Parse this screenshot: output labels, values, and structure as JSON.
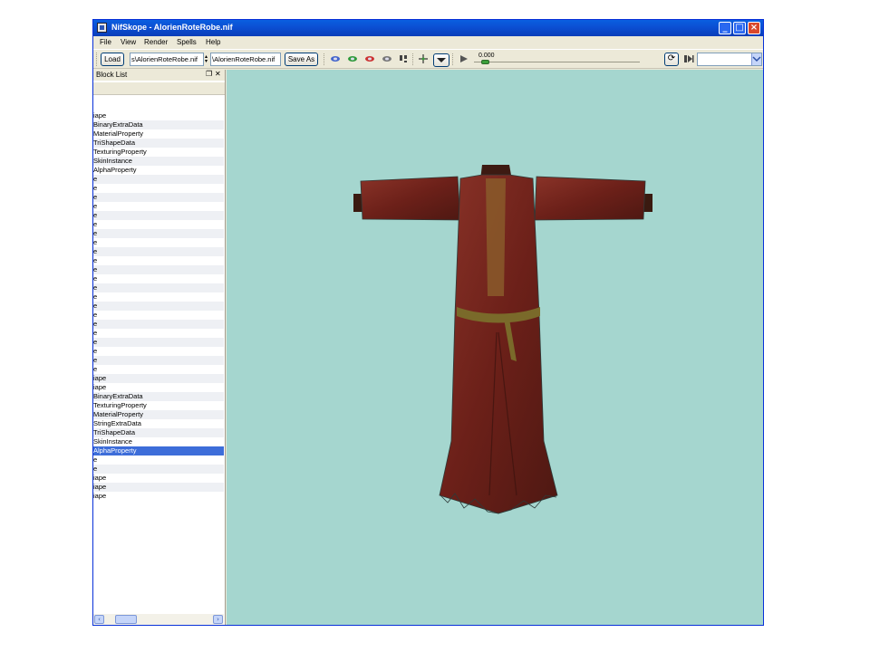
{
  "window": {
    "title": "NifSkope - AlorienRoteRobe.nif",
    "minimize_glyph": "_",
    "maximize_glyph": "□",
    "close_glyph": "×"
  },
  "menu": [
    "File",
    "View",
    "Render",
    "Spells",
    "Help"
  ],
  "toolbar": {
    "load_label": "Load",
    "load_path": "s\\AlorienRoteRobe.nif",
    "save_path": "\\AlorienRoteRobe.nif",
    "save_as_label": "Save As",
    "time_value": "0.000",
    "animation_select": ""
  },
  "block_list": {
    "header": "Block List",
    "rows": [
      "iape",
      "BinaryExtraData",
      "MaterialProperty",
      "TriShapeData",
      "TexturingProperty",
      "SkinInstance",
      "AlphaProperty",
      "e",
      "e",
      "e",
      "e",
      "e",
      "e",
      "e",
      "e",
      "e",
      "e",
      "e",
      "e",
      "e",
      "e",
      "e",
      "e",
      "e",
      "e",
      "e",
      "e",
      "e",
      "e",
      "iape",
      "iape",
      "BinaryExtraData",
      "TexturingProperty",
      "MaterialProperty",
      "StringExtraData",
      "TriShapeData",
      "SkinInstance",
      "AlphaProperty",
      "e",
      "e",
      "iape",
      "iape",
      "iape"
    ],
    "selected_index": 37
  },
  "colors": {
    "viewport_bg": "#a5d6cf",
    "robe": "#7a2a22",
    "selection": "#3d6dd9"
  }
}
